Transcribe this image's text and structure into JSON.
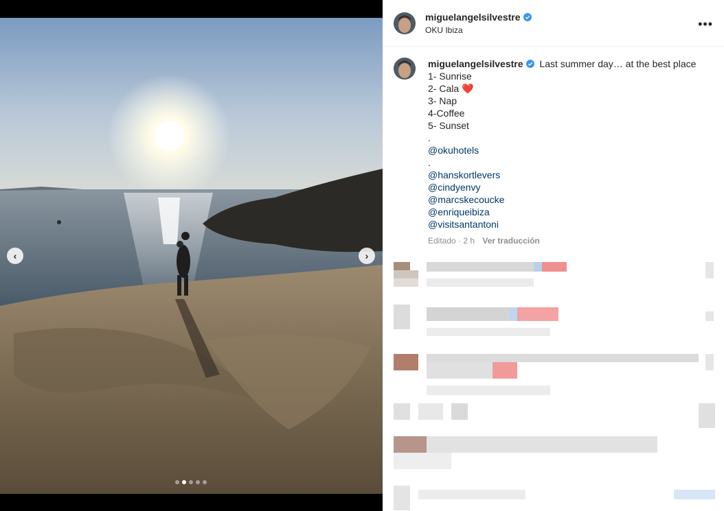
{
  "post": {
    "username": "miguelangelsilvestre",
    "location": "OKU Ibiza",
    "caption_first": "Last summer day… at the best place",
    "caption_lines": [
      "1- Sunrise",
      "2- Cala ❤️",
      "3- Nap",
      "4-Coffee",
      "5- Sunset",
      "."
    ],
    "mention1": "@okuhotels",
    "separator": ".",
    "mentions": [
      "@hanskortlevers",
      "@cindyenvy",
      "@marcskecoucke",
      "@enriqueibiza",
      "@visitsantantoni"
    ],
    "edited": "Editado · 2 h",
    "translate": "Ver traducción",
    "more_glyph": "•••"
  },
  "media": {
    "prev_glyph": "‹",
    "next_glyph": "›",
    "slide_count": 5,
    "active_slide": 2
  },
  "icons": {
    "verified": "verified-badge-icon",
    "more": "more-options-icon",
    "prev": "chevron-left-icon",
    "next": "chevron-right-icon"
  },
  "colors": {
    "verified": "#3897f0",
    "mention": "#00376b",
    "muted": "#8e8e8e"
  }
}
